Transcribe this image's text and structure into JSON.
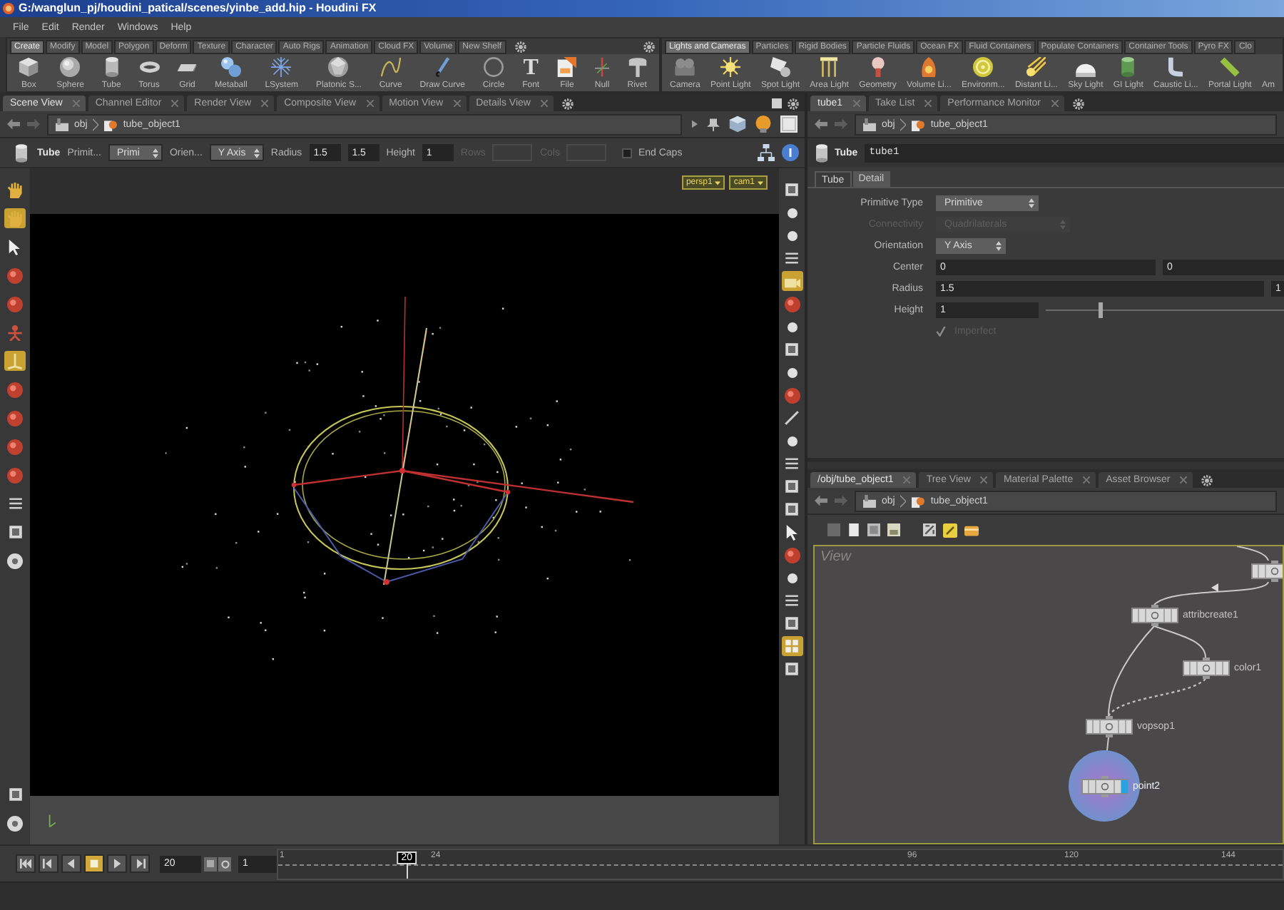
{
  "window": {
    "title": "G:/wanglun_pj/houdini_patical/scenes/yinbe_add.hip - Houdini FX"
  },
  "menu": [
    "File",
    "Edit",
    "Render",
    "Windows",
    "Help"
  ],
  "shelves": [
    {
      "tabs": [
        {
          "label": "Create",
          "selected": true
        },
        {
          "label": "Modify",
          "selected": false
        },
        {
          "label": "Model",
          "selected": false
        },
        {
          "label": "Polygon",
          "selected": false
        },
        {
          "label": "Deform",
          "selected": false
        },
        {
          "label": "Texture",
          "selected": false
        },
        {
          "label": "Character",
          "selected": false
        },
        {
          "label": "Auto Rigs",
          "selected": false
        },
        {
          "label": "Animation",
          "selected": false
        },
        {
          "label": "Cloud FX",
          "selected": false
        },
        {
          "label": "Volume",
          "selected": false
        },
        {
          "label": "New Shelf",
          "selected": false
        }
      ],
      "tools": [
        {
          "label": "Box"
        },
        {
          "label": "Sphere"
        },
        {
          "label": "Tube"
        },
        {
          "label": "Torus"
        },
        {
          "label": "Grid"
        },
        {
          "label": "Metaball"
        },
        {
          "label": "LSystem"
        },
        {
          "label": "Platonic S..."
        },
        {
          "label": "Curve"
        },
        {
          "label": "Draw Curve"
        },
        {
          "label": "Circle"
        },
        {
          "label": "Font",
          "glyph": "T"
        },
        {
          "label": "File"
        },
        {
          "label": "Null"
        },
        {
          "label": "Rivet"
        }
      ]
    },
    {
      "tabs": [
        {
          "label": "Lights and Cameras",
          "selected": true
        },
        {
          "label": "Particles",
          "selected": false
        },
        {
          "label": "Rigid Bodies",
          "selected": false
        },
        {
          "label": "Particle Fluids",
          "selected": false
        },
        {
          "label": "Ocean FX",
          "selected": false
        },
        {
          "label": "Fluid Containers",
          "selected": false
        },
        {
          "label": "Populate Containers",
          "selected": false
        },
        {
          "label": "Container Tools",
          "selected": false
        },
        {
          "label": "Pyro FX",
          "selected": false
        },
        {
          "label": "Clo",
          "selected": false
        }
      ],
      "tools": [
        {
          "label": "Camera"
        },
        {
          "label": "Point Light"
        },
        {
          "label": "Spot Light"
        },
        {
          "label": "Area Light"
        },
        {
          "label": "Geometry"
        },
        {
          "label": "Volume Li..."
        },
        {
          "label": "Environm..."
        },
        {
          "label": "Distant Li..."
        },
        {
          "label": "Sky Light"
        },
        {
          "label": "GI Light"
        },
        {
          "label": "Caustic Li..."
        },
        {
          "label": "Portal Light"
        },
        {
          "label": "Am"
        }
      ]
    }
  ],
  "scene_view": {
    "tabs": [
      {
        "label": "Scene View",
        "selected": true
      },
      {
        "label": "Channel Editor",
        "selected": false
      },
      {
        "label": "Render View",
        "selected": false
      },
      {
        "label": "Composite View",
        "selected": false
      },
      {
        "label": "Motion View",
        "selected": false
      },
      {
        "label": "Details View",
        "selected": false
      }
    ],
    "path": [
      "obj",
      "tube_object1"
    ],
    "operation": {
      "name": "Tube",
      "items": [
        {
          "kind": "label",
          "text": "Primit...",
          "disabled": false
        },
        {
          "kind": "menu",
          "text": "Primi",
          "disabled": false
        },
        {
          "kind": "label",
          "text": "Orien...",
          "disabled": false
        },
        {
          "kind": "menu",
          "text": "Y Axis",
          "disabled": false
        },
        {
          "kind": "label",
          "text": "Radius",
          "disabled": false
        },
        {
          "kind": "field",
          "text": "1.5",
          "disabled": false
        },
        {
          "kind": "field",
          "text": "1.5",
          "disabled": false
        },
        {
          "kind": "label",
          "text": "Height",
          "disabled": false
        },
        {
          "kind": "field",
          "text": "1",
          "disabled": false
        },
        {
          "kind": "label",
          "text": "Rows",
          "disabled": true
        },
        {
          "kind": "field",
          "disabled": true
        },
        {
          "kind": "label",
          "text": "Cols",
          "disabled": true
        },
        {
          "kind": "field",
          "disabled": true
        }
      ],
      "end_caps": {
        "label": "End Caps",
        "checked": false
      }
    },
    "camera_menus": [
      "persp1",
      "cam1"
    ],
    "left_tools": [
      {
        "selected": false
      },
      {
        "selected": true
      },
      {
        "selected": false
      },
      {
        "selected": false
      },
      {
        "selected": false
      },
      {
        "selected": false
      },
      {
        "selected": true
      },
      {
        "selected": false
      },
      {
        "selected": false
      },
      {
        "selected": false
      },
      {
        "selected": false
      },
      {
        "selected": false
      },
      {
        "selected": false
      },
      {
        "selected": false
      }
    ],
    "left_tools_bottom": [
      {
        "selected": false
      },
      {
        "selected": false
      }
    ],
    "right_tools": [
      {
        "selected": false
      },
      {
        "selected": false
      },
      {
        "selected": false
      },
      {
        "selected": false
      },
      {
        "selected": true
      },
      {
        "selected": false
      },
      {
        "selected": false
      },
      {
        "selected": false
      },
      {
        "selected": false
      },
      {
        "selected": false
      },
      {
        "selected": false
      },
      {
        "selected": false
      },
      {
        "selected": false
      },
      {
        "selected": false
      },
      {
        "selected": false
      },
      {
        "selected": false
      },
      {
        "selected": false
      },
      {
        "selected": false
      },
      {
        "selected": false
      },
      {
        "selected": false
      },
      {
        "selected": true
      },
      {
        "selected": false
      }
    ]
  },
  "parameter_pane": {
    "tabs": [
      {
        "label": "tube1",
        "selected": true
      },
      {
        "label": "Take List",
        "selected": false
      },
      {
        "label": "Performance Monitor",
        "selected": false
      }
    ],
    "path": [
      "obj",
      "tube_object1"
    ],
    "node": {
      "type": "Tube",
      "name": "tube1"
    },
    "sections": [
      {
        "label": "Tube",
        "selected": true
      },
      {
        "label": "Detail",
        "selected": false
      }
    ],
    "rows": [
      {
        "kind": "menu",
        "label": "Primitive Type",
        "value": "Primitive",
        "disabled": false
      },
      {
        "kind": "menu",
        "label": "Connectivity",
        "value": "Quadrilaterals",
        "disabled": true
      },
      {
        "kind": "menu",
        "label": "Orientation",
        "value": "Y Axis",
        "disabled": false
      },
      {
        "kind": "vector",
        "label": "Center",
        "values": [
          "0",
          "0"
        ],
        "disabled": false
      },
      {
        "kind": "vector",
        "label": "Radius",
        "values": [
          "1.5",
          "1"
        ],
        "disabled": false
      },
      {
        "kind": "slider",
        "label": "Height",
        "value": "1",
        "level": 0.23,
        "disabled": false
      },
      {
        "kind": "checkbox",
        "label": "Imperfect",
        "checked": true,
        "disabled": true
      }
    ]
  },
  "network_pane": {
    "tabs": [
      {
        "label": "/obj/tube_object1",
        "selected": true
      },
      {
        "label": "Tree View",
        "selected": false
      },
      {
        "label": "Material Palette",
        "selected": false
      },
      {
        "label": "Asset Browser",
        "selected": false
      }
    ],
    "path": [
      "obj",
      "tube_object1"
    ],
    "view_label": "View",
    "nodes": [
      {
        "selected": false
      },
      {
        "label": "attribcreate1",
        "selected": false
      },
      {
        "label": "color1",
        "selected": false
      },
      {
        "label": "vopsop1",
        "selected": false
      },
      {
        "label": "point2",
        "selected": true
      }
    ]
  },
  "timeline": {
    "buttons": [
      {
        "selected": false
      },
      {
        "selected": false
      },
      {
        "selected": false
      },
      {
        "selected": true
      },
      {
        "selected": false
      },
      {
        "selected": false
      }
    ],
    "frame": "20",
    "field_2": "1",
    "ruler_labels": [
      "1",
      "24",
      "96",
      "120",
      "144"
    ],
    "playhead": {
      "label": "20",
      "level": 0.128
    }
  }
}
